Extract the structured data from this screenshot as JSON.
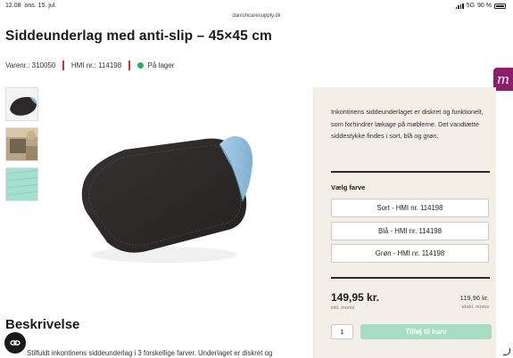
{
  "status_bar": {
    "time": "12.08",
    "date": "ons. 15. jul.",
    "url": "danishcaresupply.dk",
    "network": "5G",
    "battery": "90 %"
  },
  "product": {
    "title": "Siddeunderlag med anti-slip – 45×45 cm",
    "item_number": "Varenr.: 310050",
    "hmi_number": "HMI nr.: 114198",
    "stock_status": "På lager",
    "brand_badge": "m"
  },
  "colors": {
    "brand": "#8e1e6b",
    "in_stock": "#27ae60",
    "separator": "#c0392b",
    "cart_button": "#a7dcc0",
    "panel_bg": "#f3efe6"
  },
  "thumbnails": [
    {
      "name": "Sort",
      "color": "#2f2c29"
    },
    {
      "name": "Blå",
      "color": "#7f7058"
    },
    {
      "name": "Grøn",
      "color": "#a6e0cf"
    }
  ],
  "purchase_panel": {
    "description": "Inkontinens siddeunderlaget er diskret og funktionelt, som forhindrer lækage på møblerne. Det vandtætte siddestykke findes i sort, blå og grøn.",
    "color_label": "Vælg farve",
    "options": [
      "Sort - HMI nr. 114198",
      "Blå - HMI nr. 114198",
      "Grøn - HMI nr. 114198"
    ],
    "price": "149,95 kr.",
    "price_note": "inkl. moms",
    "price_ex": "119,96 kr.",
    "price_ex_note": "ekskl. moms",
    "quantity": "1",
    "add_to_cart": "Tilføj til kurv"
  },
  "description": {
    "heading": "Beskrivelse",
    "text": "Stilfuldt inkontinens siddeunderlag i 3 forskellige farver. Underlaget er diskret og"
  }
}
